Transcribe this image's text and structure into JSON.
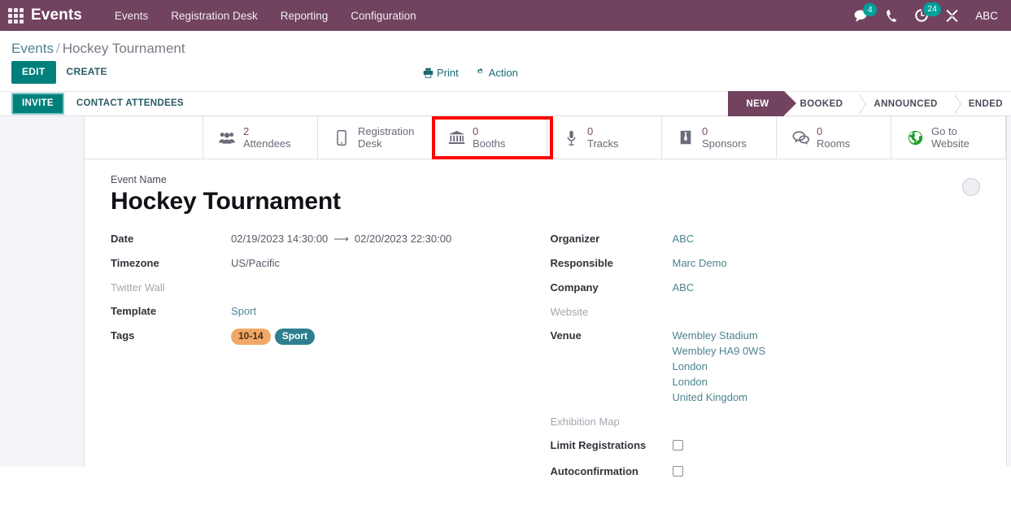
{
  "navbar": {
    "apps_icon": "apps-grid-icon",
    "brand": "Events",
    "menu": [
      {
        "label": "Events"
      },
      {
        "label": "Registration Desk"
      },
      {
        "label": "Reporting"
      },
      {
        "label": "Configuration"
      }
    ],
    "systray": {
      "messages_icon": "messages-icon",
      "messages_count": "4",
      "phone_icon": "phone-icon",
      "activity_icon": "activity-clock-icon",
      "activity_count": "24",
      "debug_icon": "debug-tools-icon",
      "username": "ABC"
    },
    "accent": "#71435f",
    "badge_color": "#00a09d"
  },
  "control_panel": {
    "breadcrumb": {
      "root": "Events",
      "separator": "/",
      "current": "Hockey Tournament"
    },
    "edit_label": "EDIT",
    "create_label": "CREATE",
    "print_label": "Print",
    "print_icon": "printer-icon",
    "action_label": "Action",
    "action_icon": "gear-icon"
  },
  "status_row": {
    "invite_label": "INVITE",
    "contact_attendees_label": "CONTACT ATTENDEES",
    "stages": [
      {
        "label": "NEW",
        "active": true
      },
      {
        "label": "BOOKED",
        "active": false
      },
      {
        "label": "ANNOUNCED",
        "active": false
      },
      {
        "label": "ENDED",
        "active": false
      }
    ]
  },
  "smart_buttons": [
    {
      "icon": "users-icon",
      "value": "2",
      "label": "Attendees"
    },
    {
      "icon": "mobile-phone-icon",
      "value": "",
      "label": "Registration\nDesk"
    },
    {
      "icon": "bank-booth-icon",
      "value": "0",
      "label": "Booths",
      "highlighted": true
    },
    {
      "icon": "microphone-icon",
      "value": "0",
      "label": "Tracks"
    },
    {
      "icon": "tie-sponsor-icon",
      "value": "0",
      "label": "Sponsors"
    },
    {
      "icon": "chat-rooms-icon",
      "value": "0",
      "label": "Rooms"
    },
    {
      "icon": "globe-icon",
      "value": "",
      "label": "Go to\nWebsite"
    }
  ],
  "highlight_color": "#ff0000",
  "form": {
    "title_label": "Event Name",
    "title": "Hockey Tournament",
    "avatar": "image-placeholder-circle",
    "left_fields": {
      "date_label": "Date",
      "date_start": "02/19/2023 14:30:00",
      "date_arrow": "⟶",
      "date_end": "02/20/2023 22:30:00",
      "timezone_label": "Timezone",
      "timezone_value": "US/Pacific",
      "twitter_wall_label": "Twitter Wall",
      "twitter_wall_value": "",
      "template_label": "Template",
      "template_value": "Sport",
      "tags_label": "Tags",
      "tags": [
        {
          "label": "10-14",
          "color": "#f0a868",
          "text_color": "#4a3018"
        },
        {
          "label": "Sport",
          "color": "#2d7f8e",
          "text_color": "#ffffff"
        }
      ]
    },
    "right_fields": {
      "organizer_label": "Organizer",
      "organizer_value": "ABC",
      "responsible_label": "Responsible",
      "responsible_value": "Marc Demo",
      "company_label": "Company",
      "company_value": "ABC",
      "website_label": "Website",
      "website_value": "",
      "venue_label": "Venue",
      "venue_lines": [
        "Wembley Stadium",
        "Wembley HA9 0WS",
        "London",
        "London",
        "United Kingdom"
      ],
      "exhibition_map_label": "Exhibition Map",
      "exhibition_map_value": "",
      "limit_registrations_label": "Limit Registrations",
      "limit_registrations_checked": false,
      "autoconfirmation_label": "Autoconfirmation",
      "autoconfirmation_checked": false
    }
  }
}
